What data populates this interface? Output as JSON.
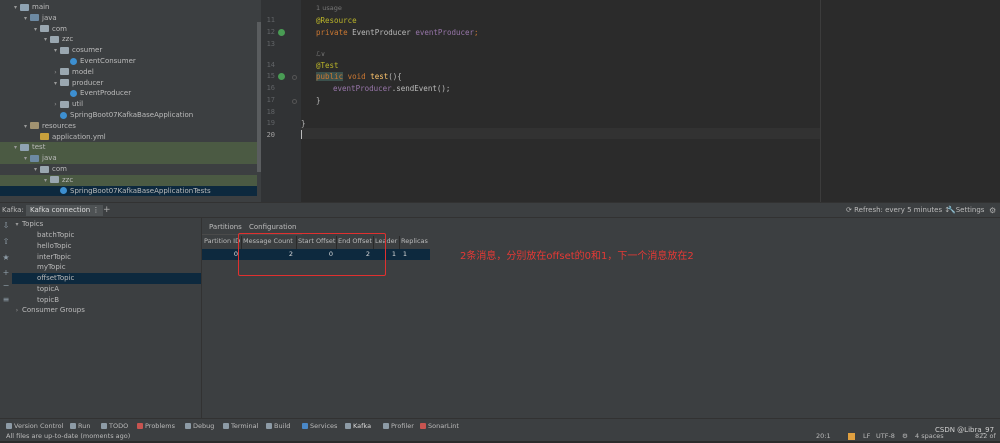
{
  "project_tree": [
    {
      "label": "main",
      "type": "folder",
      "indent": 1,
      "open": true
    },
    {
      "label": "java",
      "type": "src",
      "indent": 2,
      "open": true
    },
    {
      "label": "com",
      "type": "pkg",
      "indent": 3,
      "open": true
    },
    {
      "label": "zzc",
      "type": "pkg",
      "indent": 4,
      "open": true
    },
    {
      "label": "cosumer",
      "type": "pkg",
      "indent": 5,
      "open": true
    },
    {
      "label": "EventConsumer",
      "type": "cls",
      "indent": 6
    },
    {
      "label": "model",
      "type": "pkg",
      "indent": 5,
      "open": false
    },
    {
      "label": "producer",
      "type": "pkg",
      "indent": 5,
      "open": true
    },
    {
      "label": "EventProducer",
      "type": "cls",
      "indent": 6
    },
    {
      "label": "util",
      "type": "pkg",
      "indent": 5,
      "open": false
    },
    {
      "label": "SpringBoot07KafkaBaseApplication",
      "type": "cls",
      "indent": 5
    },
    {
      "label": "resources",
      "type": "res",
      "indent": 2,
      "open": true
    },
    {
      "label": "application.yml",
      "type": "yml",
      "indent": 3
    },
    {
      "label": "test",
      "type": "folder",
      "indent": 1,
      "open": true,
      "hl": true
    },
    {
      "label": "java",
      "type": "src",
      "indent": 2,
      "open": true,
      "hl": true
    },
    {
      "label": "com",
      "type": "pkg",
      "indent": 3,
      "open": true
    },
    {
      "label": "zzc",
      "type": "pkg",
      "indent": 4,
      "open": true,
      "hl": true
    },
    {
      "label": "SpringBoot07KafkaBaseApplicationTests",
      "type": "cls",
      "indent": 5,
      "sel": true
    }
  ],
  "editor": {
    "usage_hint": "1 usage",
    "lines": [
      {
        "n": "11",
        "html_key": "l11"
      },
      {
        "n": "12",
        "html_key": "l12"
      },
      {
        "n": "13",
        "html_key": "l13"
      },
      {
        "n": "14",
        "html_key": "l14"
      },
      {
        "n": "15",
        "html_key": "l15"
      },
      {
        "n": "16",
        "html_key": "l16"
      },
      {
        "n": "17",
        "html_key": "l17"
      },
      {
        "n": "18",
        "html_key": "l18"
      },
      {
        "n": "19",
        "html_key": "l19"
      },
      {
        "n": "20",
        "html_key": "l20"
      }
    ],
    "code": {
      "resource_ann": "@Resource",
      "private_kw": "private",
      "producer_type": " EventProducer ",
      "producer_field": "eventProducer",
      "semi": ";",
      "test_ann": "@Test",
      "public_kw": "public",
      "void_kw": " void ",
      "method": "test",
      "method_tail": "(){",
      "call_field": "eventProducer",
      "call_tail": ".sendEvent();",
      "close_brace": "}",
      "class_close": "}",
      "inlay": "ℒ∨"
    }
  },
  "kafka": {
    "panel_label": "Kafka:",
    "connection_tab": "Kafka connection",
    "menu_dots": "⋮",
    "plus": "+",
    "refresh": "Refresh: every 5 minutes ↕",
    "settings": "Settings",
    "topics_header": "Topics",
    "topics": [
      "batchTopic",
      "helloTopic",
      "interTopic",
      "myTopic",
      "offsetTopic",
      "topicA",
      "topicB"
    ],
    "selected_topic": "offsetTopic",
    "consumer_groups": "Consumer Groups",
    "tabs": [
      "Partitions",
      "Configuration"
    ],
    "columns": [
      "Partition ID",
      "Message Count",
      "Start Offset",
      "End Offset",
      "Leader",
      "Replicas"
    ],
    "rows": [
      [
        "0",
        "2",
        "0",
        "2",
        "1",
        "1"
      ]
    ]
  },
  "annotation": "2条消息，分别放在offset的0和1，下一个消息放在2",
  "tool_windows": [
    "Version Control",
    "Run",
    "TODO",
    "Problems",
    "Debug",
    "Terminal",
    "Build",
    "Services",
    "Kafka",
    "Profiler",
    "SonarLint"
  ],
  "status": {
    "message": "All files are up-to-date (moments ago)",
    "position": "20:1",
    "line_sep": "LF",
    "encoding": "UTF-8",
    "indent": "4 spaces",
    "memory": "822 of"
  },
  "watermark": "CSDN @Libra_97",
  "colors": {
    "annotation": "#e53935",
    "selection": "#0d293e",
    "highlight": "#4b5a43"
  }
}
